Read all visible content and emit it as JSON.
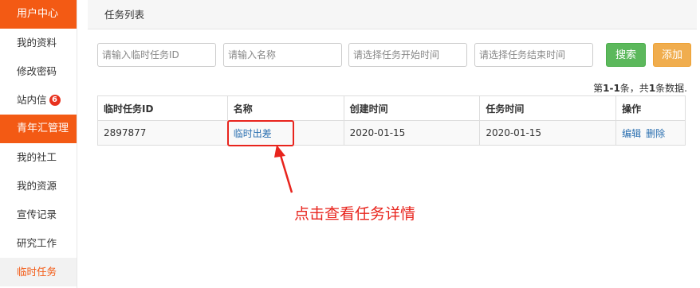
{
  "sidebar": {
    "groups": [
      {
        "title": "用户中心",
        "items": [
          {
            "label": "我的资料"
          },
          {
            "label": "修改密码"
          },
          {
            "label": "站内信",
            "badge": "6"
          }
        ]
      },
      {
        "title": "青年汇管理",
        "items": [
          {
            "label": "我的社工"
          },
          {
            "label": "我的资源"
          },
          {
            "label": "宣传记录"
          },
          {
            "label": "研究工作"
          },
          {
            "label": "临时任务",
            "active": true
          }
        ]
      }
    ]
  },
  "panel": {
    "title": "任务列表"
  },
  "filters": {
    "id_placeholder": "请输入临时任务ID",
    "name_placeholder": "请输入名称",
    "start_placeholder": "请选择任务开始时间",
    "end_placeholder": "请选择任务结束时间",
    "search_label": "搜索",
    "add_label": "添加"
  },
  "count": {
    "prefix": "第",
    "range": "1-1",
    "mid": "条，共",
    "total": "1",
    "suffix": "条数据."
  },
  "table": {
    "headers": [
      "临时任务ID",
      "名称",
      "创建时间",
      "任务时间",
      "操作"
    ],
    "rows": [
      {
        "id": "2897877",
        "name": "临时出差",
        "created": "2020-01-15",
        "task_time": "2020-01-15",
        "edit_label": "编辑",
        "delete_label": "删除"
      }
    ]
  },
  "annotation": {
    "text": "点击查看任务详情",
    "color": "#e8241d"
  },
  "colors": {
    "brand": "#f35a14",
    "search": "#5cb85c",
    "add": "#f0ad4e",
    "link": "#2a6fb0"
  }
}
